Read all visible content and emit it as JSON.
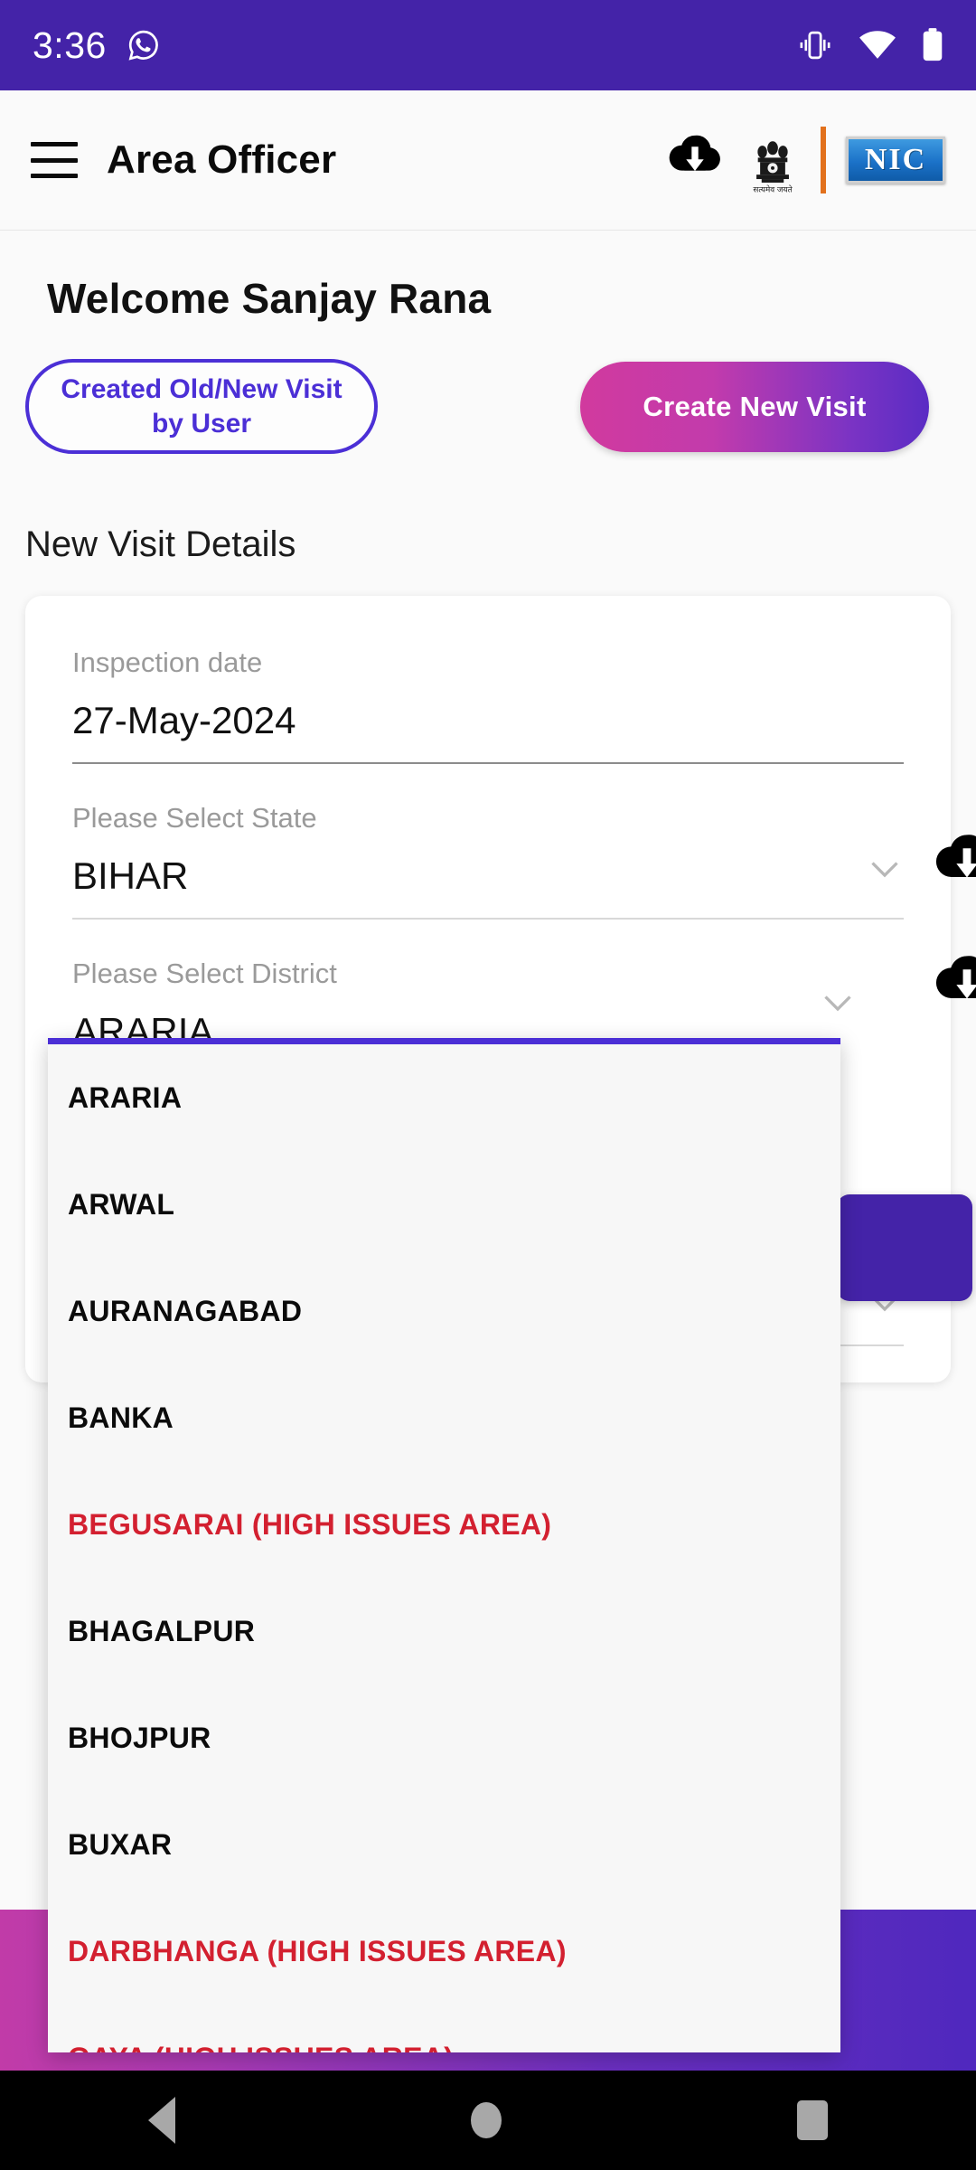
{
  "status_bar": {
    "time": "3:36",
    "icons": [
      "whatsapp-icon",
      "vibrate-icon",
      "wifi-icon",
      "battery-icon"
    ],
    "background_color": "#4423A8"
  },
  "app_bar": {
    "menu_icon": "hamburger-menu-icon",
    "title": "Area Officer",
    "download_icon": "cloud-download-icon",
    "emblem_icon": "india-national-emblem",
    "emblem_caption": "सत्यमेव जयते",
    "logo_text": "NIC"
  },
  "main": {
    "welcome_text": "Welcome Sanjay Rana",
    "created_visit_button": "Created Old/New Visit by User",
    "create_new_visit_button": "Create New Visit",
    "section_title": "New Visit Details",
    "accent_purple": "#4423A8",
    "accent_violet": "#4b2fd6",
    "high_issue_red": "#D32030"
  },
  "form": {
    "inspection_date": {
      "label": "Inspection date",
      "value": "27-May-2024"
    },
    "state": {
      "label": "Please Select State",
      "value": "BIHAR"
    },
    "district": {
      "label": "Please Select District",
      "value": "ARARIA"
    }
  },
  "dropdown": {
    "items": [
      {
        "label": "ARARIA",
        "high_issue": false
      },
      {
        "label": "ARWAL",
        "high_issue": false
      },
      {
        "label": "AURANAGABAD",
        "high_issue": false
      },
      {
        "label": "BANKA",
        "high_issue": false
      },
      {
        "label": "BEGUSARAI (HIGH ISSUES AREA)",
        "high_issue": true
      },
      {
        "label": "BHAGALPUR",
        "high_issue": false
      },
      {
        "label": "BHOJPUR",
        "high_issue": false
      },
      {
        "label": "BUXAR",
        "high_issue": false
      },
      {
        "label": "DARBHANGA (HIGH ISSUES AREA)",
        "high_issue": true
      },
      {
        "label": "GAYA (HIGH ISSUES AREA)",
        "high_issue": true
      }
    ]
  },
  "nav_bar": {
    "back": "back-triangle-icon",
    "home": "home-circle-icon",
    "recents": "recents-square-icon"
  }
}
